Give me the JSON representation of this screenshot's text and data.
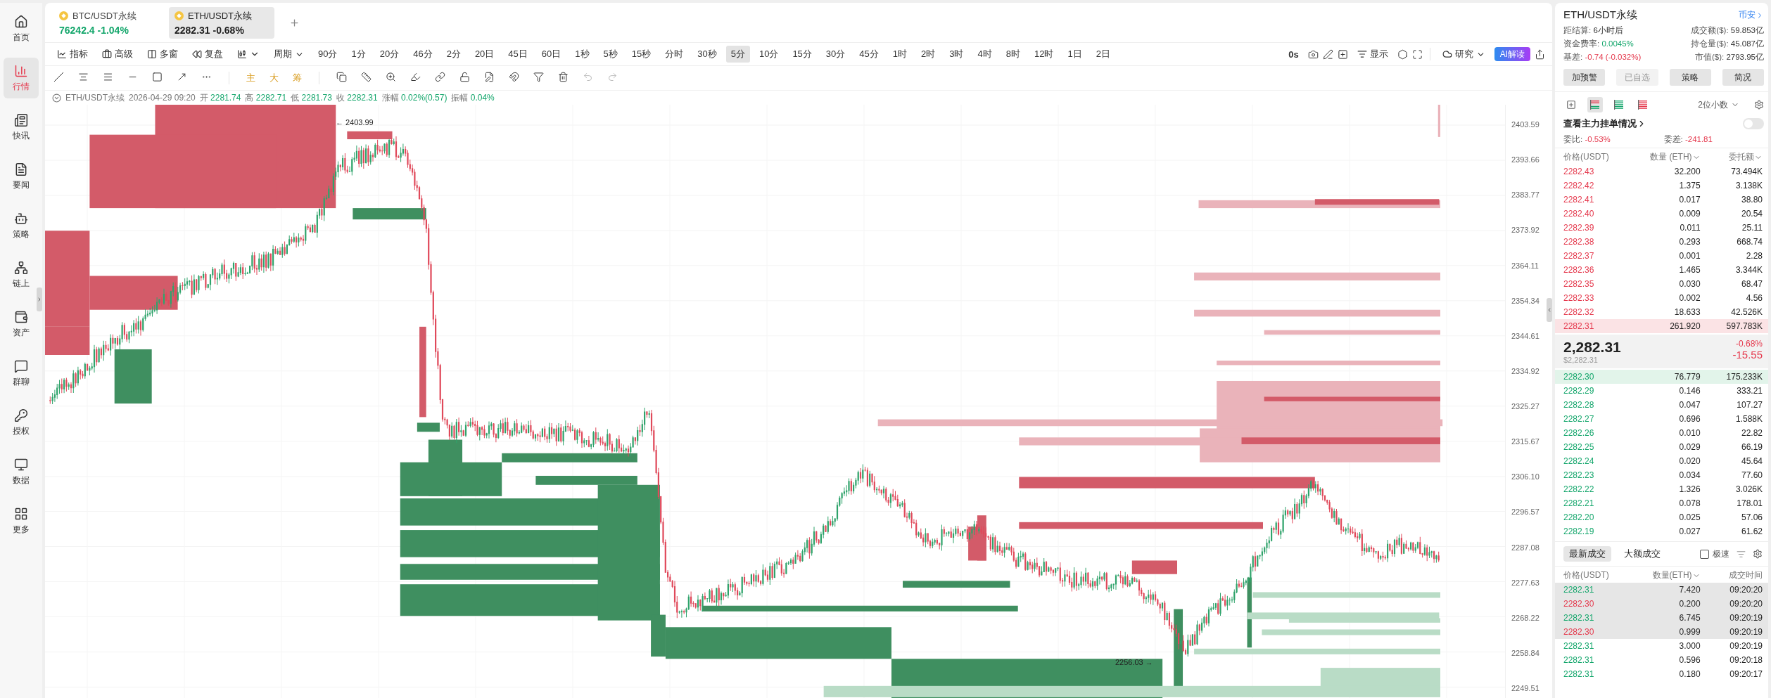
{
  "sidebar": {
    "items": [
      {
        "label": "首页",
        "selected": false
      },
      {
        "label": "行情",
        "selected": true
      },
      {
        "label": "快讯",
        "selected": false
      },
      {
        "label": "要闻",
        "selected": false
      },
      {
        "label": "策略",
        "selected": false
      },
      {
        "label": "链上",
        "selected": false
      },
      {
        "label": "资产",
        "selected": false
      },
      {
        "label": "群聊",
        "selected": false
      },
      {
        "label": "授权",
        "selected": false
      },
      {
        "label": "数据",
        "selected": false
      },
      {
        "label": "更多",
        "selected": false
      }
    ]
  },
  "symbol_tabs": [
    {
      "name": "BTC/USDT永续",
      "price": "76242.4",
      "change": "-1.04%",
      "selected": false
    },
    {
      "name": "ETH/USDT永续",
      "price": "2282.31",
      "change": "-0.68%",
      "selected": true
    }
  ],
  "chart_toolbar": {
    "tools": [
      "指标",
      "高级",
      "多窗",
      "复盘"
    ],
    "period_label": "周期",
    "intervals": [
      {
        "label": "90分",
        "selected": false
      },
      {
        "label": "1分",
        "selected": false
      },
      {
        "label": "20分",
        "selected": false
      },
      {
        "label": "46分",
        "selected": false
      },
      {
        "label": "2分",
        "selected": false
      },
      {
        "label": "20日",
        "selected": false
      },
      {
        "label": "45日",
        "selected": false
      },
      {
        "label": "60日",
        "selected": false
      },
      {
        "label": "1秒",
        "selected": false
      },
      {
        "label": "5秒",
        "selected": false
      },
      {
        "label": "15秒",
        "selected": false
      },
      {
        "label": "分时",
        "selected": false
      },
      {
        "label": "30秒",
        "selected": false
      },
      {
        "label": "5分",
        "selected": true
      },
      {
        "label": "10分",
        "selected": false
      },
      {
        "label": "15分",
        "selected": false
      },
      {
        "label": "30分",
        "selected": false
      },
      {
        "label": "45分",
        "selected": false
      },
      {
        "label": "1时",
        "selected": false
      },
      {
        "label": "2时",
        "selected": false
      },
      {
        "label": "3时",
        "selected": false
      },
      {
        "label": "4时",
        "selected": false
      },
      {
        "label": "8时",
        "selected": false
      },
      {
        "label": "12时",
        "selected": false
      },
      {
        "label": "1日",
        "selected": false
      },
      {
        "label": "2日",
        "selected": false
      }
    ],
    "countdown": "0s",
    "display": "显示",
    "research": "研究",
    "ai_button": "AI解读"
  },
  "drawing_toolbar": {
    "overlays": [
      "主",
      "大",
      "筹"
    ]
  },
  "ohlc": {
    "symbol": "ETH/USDT永续",
    "time": "2026-04-29 09:20",
    "fields": [
      {
        "label": "开",
        "value": "2281.74"
      },
      {
        "label": "高",
        "value": "2282.71"
      },
      {
        "label": "低",
        "value": "2281.73"
      },
      {
        "label": "收",
        "value": "2282.31"
      },
      {
        "label": "涨幅",
        "value": "0.02%(0.57)"
      },
      {
        "label": "振幅",
        "value": "0.04%"
      }
    ]
  },
  "chart": {
    "price_ticks": [
      "2403.59",
      "2393.66",
      "2383.77",
      "2373.92",
      "2364.11",
      "2354.34",
      "2344.61",
      "2334.92",
      "2325.27",
      "2315.67",
      "2306.10",
      "2296.57",
      "2287.08",
      "2277.63",
      "2268.22",
      "2258.84",
      "2249.51"
    ],
    "high_marker": "← 2403.99",
    "low_marker": "2256.03 →"
  },
  "panel": {
    "title": "ETH/USDT永续",
    "exchange": "币安",
    "stats": [
      {
        "label": "距结算:",
        "value": "6小时后"
      },
      {
        "label": "成交额($):",
        "value": "59.853亿"
      },
      {
        "label": "资金费率:",
        "value": "0.0045%",
        "color": "#13a66b"
      },
      {
        "label": "持仓量($):",
        "value": "45.087亿"
      },
      {
        "label": "基差:",
        "value": "-0.74 (-0.032%)",
        "color": "#e5394d"
      },
      {
        "label": "市值($):",
        "value": "2793.95亿"
      }
    ],
    "actions": [
      {
        "label": "加预警",
        "disabled": false
      },
      {
        "label": "已自选",
        "disabled": true
      },
      {
        "label": "策略",
        "disabled": false
      },
      {
        "label": "简况",
        "disabled": false
      }
    ],
    "depth_views": [
      {
        "selected": false
      },
      {
        "selected": true
      },
      {
        "selected": false
      },
      {
        "selected": false
      }
    ],
    "precision": "2位小数",
    "main_orders": {
      "label": "查看主力挂单情况",
      "on": false
    },
    "ratio": {
      "label": "委比:",
      "value": "-0.53%"
    },
    "diff": {
      "label": "委差:",
      "value": "-241.81"
    },
    "book_columns": [
      "价格(USDT)",
      "数量 (ETH)",
      "委托额"
    ],
    "asks": [
      {
        "price": "2282.43",
        "qty": "32.200",
        "total": "73.494K",
        "highlighted": false
      },
      {
        "price": "2282.42",
        "qty": "1.375",
        "total": "3.138K",
        "highlighted": false
      },
      {
        "price": "2282.41",
        "qty": "0.017",
        "total": "38.80",
        "highlighted": false
      },
      {
        "price": "2282.40",
        "qty": "0.009",
        "total": "20.54",
        "highlighted": false
      },
      {
        "price": "2282.39",
        "qty": "0.011",
        "total": "25.11",
        "highlighted": false
      },
      {
        "price": "2282.38",
        "qty": "0.293",
        "total": "668.74",
        "highlighted": false
      },
      {
        "price": "2282.37",
        "qty": "0.001",
        "total": "2.28",
        "highlighted": false
      },
      {
        "price": "2282.36",
        "qty": "1.465",
        "total": "3.344K",
        "highlighted": false
      },
      {
        "price": "2282.35",
        "qty": "0.030",
        "total": "68.47",
        "highlighted": false
      },
      {
        "price": "2282.33",
        "qty": "0.002",
        "total": "4.56",
        "highlighted": false
      },
      {
        "price": "2282.32",
        "qty": "18.633",
        "total": "42.526K",
        "highlighted": false
      },
      {
        "price": "2282.31",
        "qty": "261.920",
        "total": "597.783K",
        "highlighted": true
      }
    ],
    "last": {
      "price": "2,282.31",
      "usd": "$2,282.31",
      "change_pct": "-0.68%",
      "change": "-15.55"
    },
    "bids": [
      {
        "price": "2282.30",
        "qty": "76.779",
        "total": "175.233K",
        "highlighted": true
      },
      {
        "price": "2282.29",
        "qty": "0.146",
        "total": "333.21",
        "highlighted": false
      },
      {
        "price": "2282.28",
        "qty": "0.047",
        "total": "107.27",
        "highlighted": false
      },
      {
        "price": "2282.27",
        "qty": "0.696",
        "total": "1.588K",
        "highlighted": false
      },
      {
        "price": "2282.26",
        "qty": "0.010",
        "total": "22.82",
        "highlighted": false
      },
      {
        "price": "2282.25",
        "qty": "0.029",
        "total": "66.19",
        "highlighted": false
      },
      {
        "price": "2282.24",
        "qty": "0.020",
        "total": "45.64",
        "highlighted": false
      },
      {
        "price": "2282.23",
        "qty": "0.034",
        "total": "77.60",
        "highlighted": false
      },
      {
        "price": "2282.22",
        "qty": "1.326",
        "total": "3.026K",
        "highlighted": false
      },
      {
        "price": "2282.21",
        "qty": "0.078",
        "total": "178.01",
        "highlighted": false
      },
      {
        "price": "2282.20",
        "qty": "0.025",
        "total": "57.06",
        "highlighted": false
      },
      {
        "price": "2282.19",
        "qty": "0.027",
        "total": "61.62",
        "highlighted": false
      }
    ],
    "trade_tabs": [
      {
        "label": "最新成交",
        "selected": true
      },
      {
        "label": "大额成交",
        "selected": false
      }
    ],
    "fast_mode": {
      "label": "极速",
      "checked": false
    },
    "trade_columns": [
      "价格(USDT)",
      "数量(ETH)",
      "成交时间"
    ],
    "trades": [
      {
        "price": "2282.31",
        "qty": "7.420",
        "time": "09:20:20",
        "color": "#13a66b",
        "highlighted": true
      },
      {
        "price": "2282.30",
        "qty": "0.200",
        "time": "09:20:20",
        "color": "#e5394d",
        "highlighted": true
      },
      {
        "price": "2282.31",
        "qty": "6.745",
        "time": "09:20:19",
        "color": "#13a66b",
        "highlighted": true
      },
      {
        "price": "2282.30",
        "qty": "0.999",
        "time": "09:20:19",
        "color": "#e5394d",
        "highlighted": true
      },
      {
        "price": "2282.31",
        "qty": "3.000",
        "time": "09:20:19",
        "color": "#13a66b",
        "highlighted": false
      },
      {
        "price": "2282.31",
        "qty": "0.596",
        "time": "09:20:18",
        "color": "#13a66b",
        "highlighted": false
      },
      {
        "price": "2282.31",
        "qty": "0.180",
        "time": "09:20:17",
        "color": "#13a66b",
        "highlighted": false
      }
    ]
  }
}
